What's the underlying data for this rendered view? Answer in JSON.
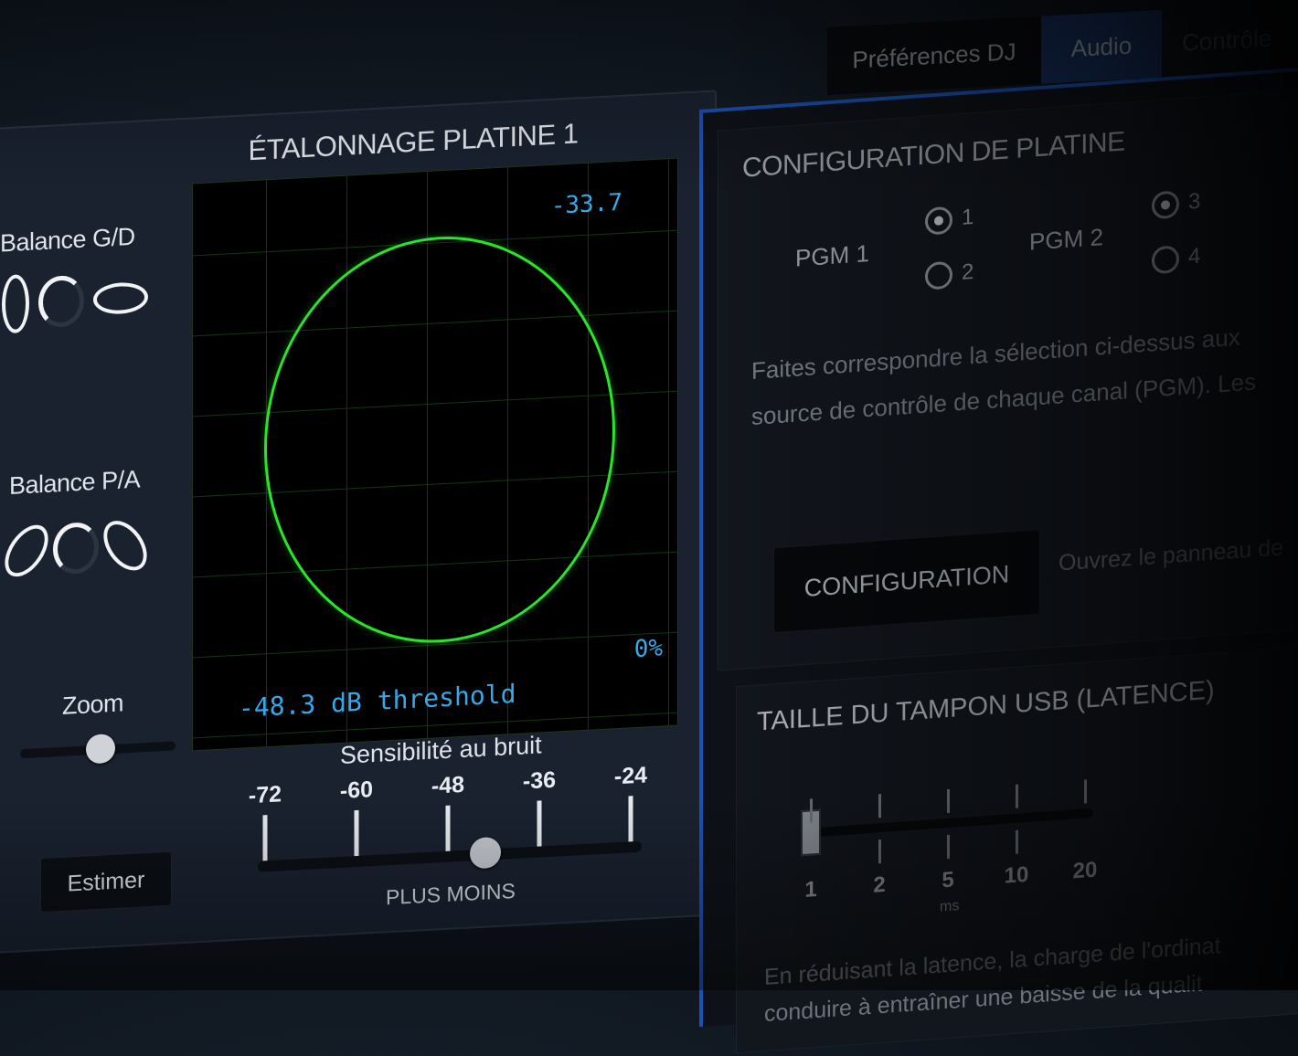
{
  "calibration": {
    "title": "ÉTALONNAGE PLATINE 1",
    "balance_lr_label": "Balance G/D",
    "balance_fb_label": "Balance P/A",
    "zoom_label": "Zoom",
    "estimate_button": "Estimer",
    "scope": {
      "top_value": "-33.7",
      "percent_value": "0%",
      "threshold_text": "-48.3 dB threshold"
    },
    "noise": {
      "title": "Sensibilité au bruit",
      "ticks": [
        "-72",
        "-60",
        "-48",
        "-36",
        "-24"
      ],
      "footer": "PLUS MOINS"
    }
  },
  "tabs": {
    "dj_prefs": "Préférences DJ",
    "audio": "Audio",
    "more": "Contrôle"
  },
  "config": {
    "title": "CONFIGURATION DE PLATINE",
    "pgm1_label": "PGM 1",
    "pgm2_label": "PGM 2",
    "radio_1": "1",
    "radio_2": "2",
    "radio_3": "3",
    "radio_4": "4",
    "description_line1": "Faites correspondre la sélection ci-dessus aux",
    "description_line2": "source de contrôle de chaque canal (PGM). Les",
    "button": "CONFIGURATION",
    "hint": "Ouvrez le panneau de"
  },
  "usb": {
    "title": "TAILLE DU TAMPON USB (LATENCE)",
    "ticks": [
      "1",
      "2",
      "5",
      "10",
      "20"
    ],
    "unit": "ms",
    "description_line1": "En réduisant la latence, la charge de l'ordinat",
    "description_line2": "conduire à entraîner une baisse de la qualit"
  }
}
